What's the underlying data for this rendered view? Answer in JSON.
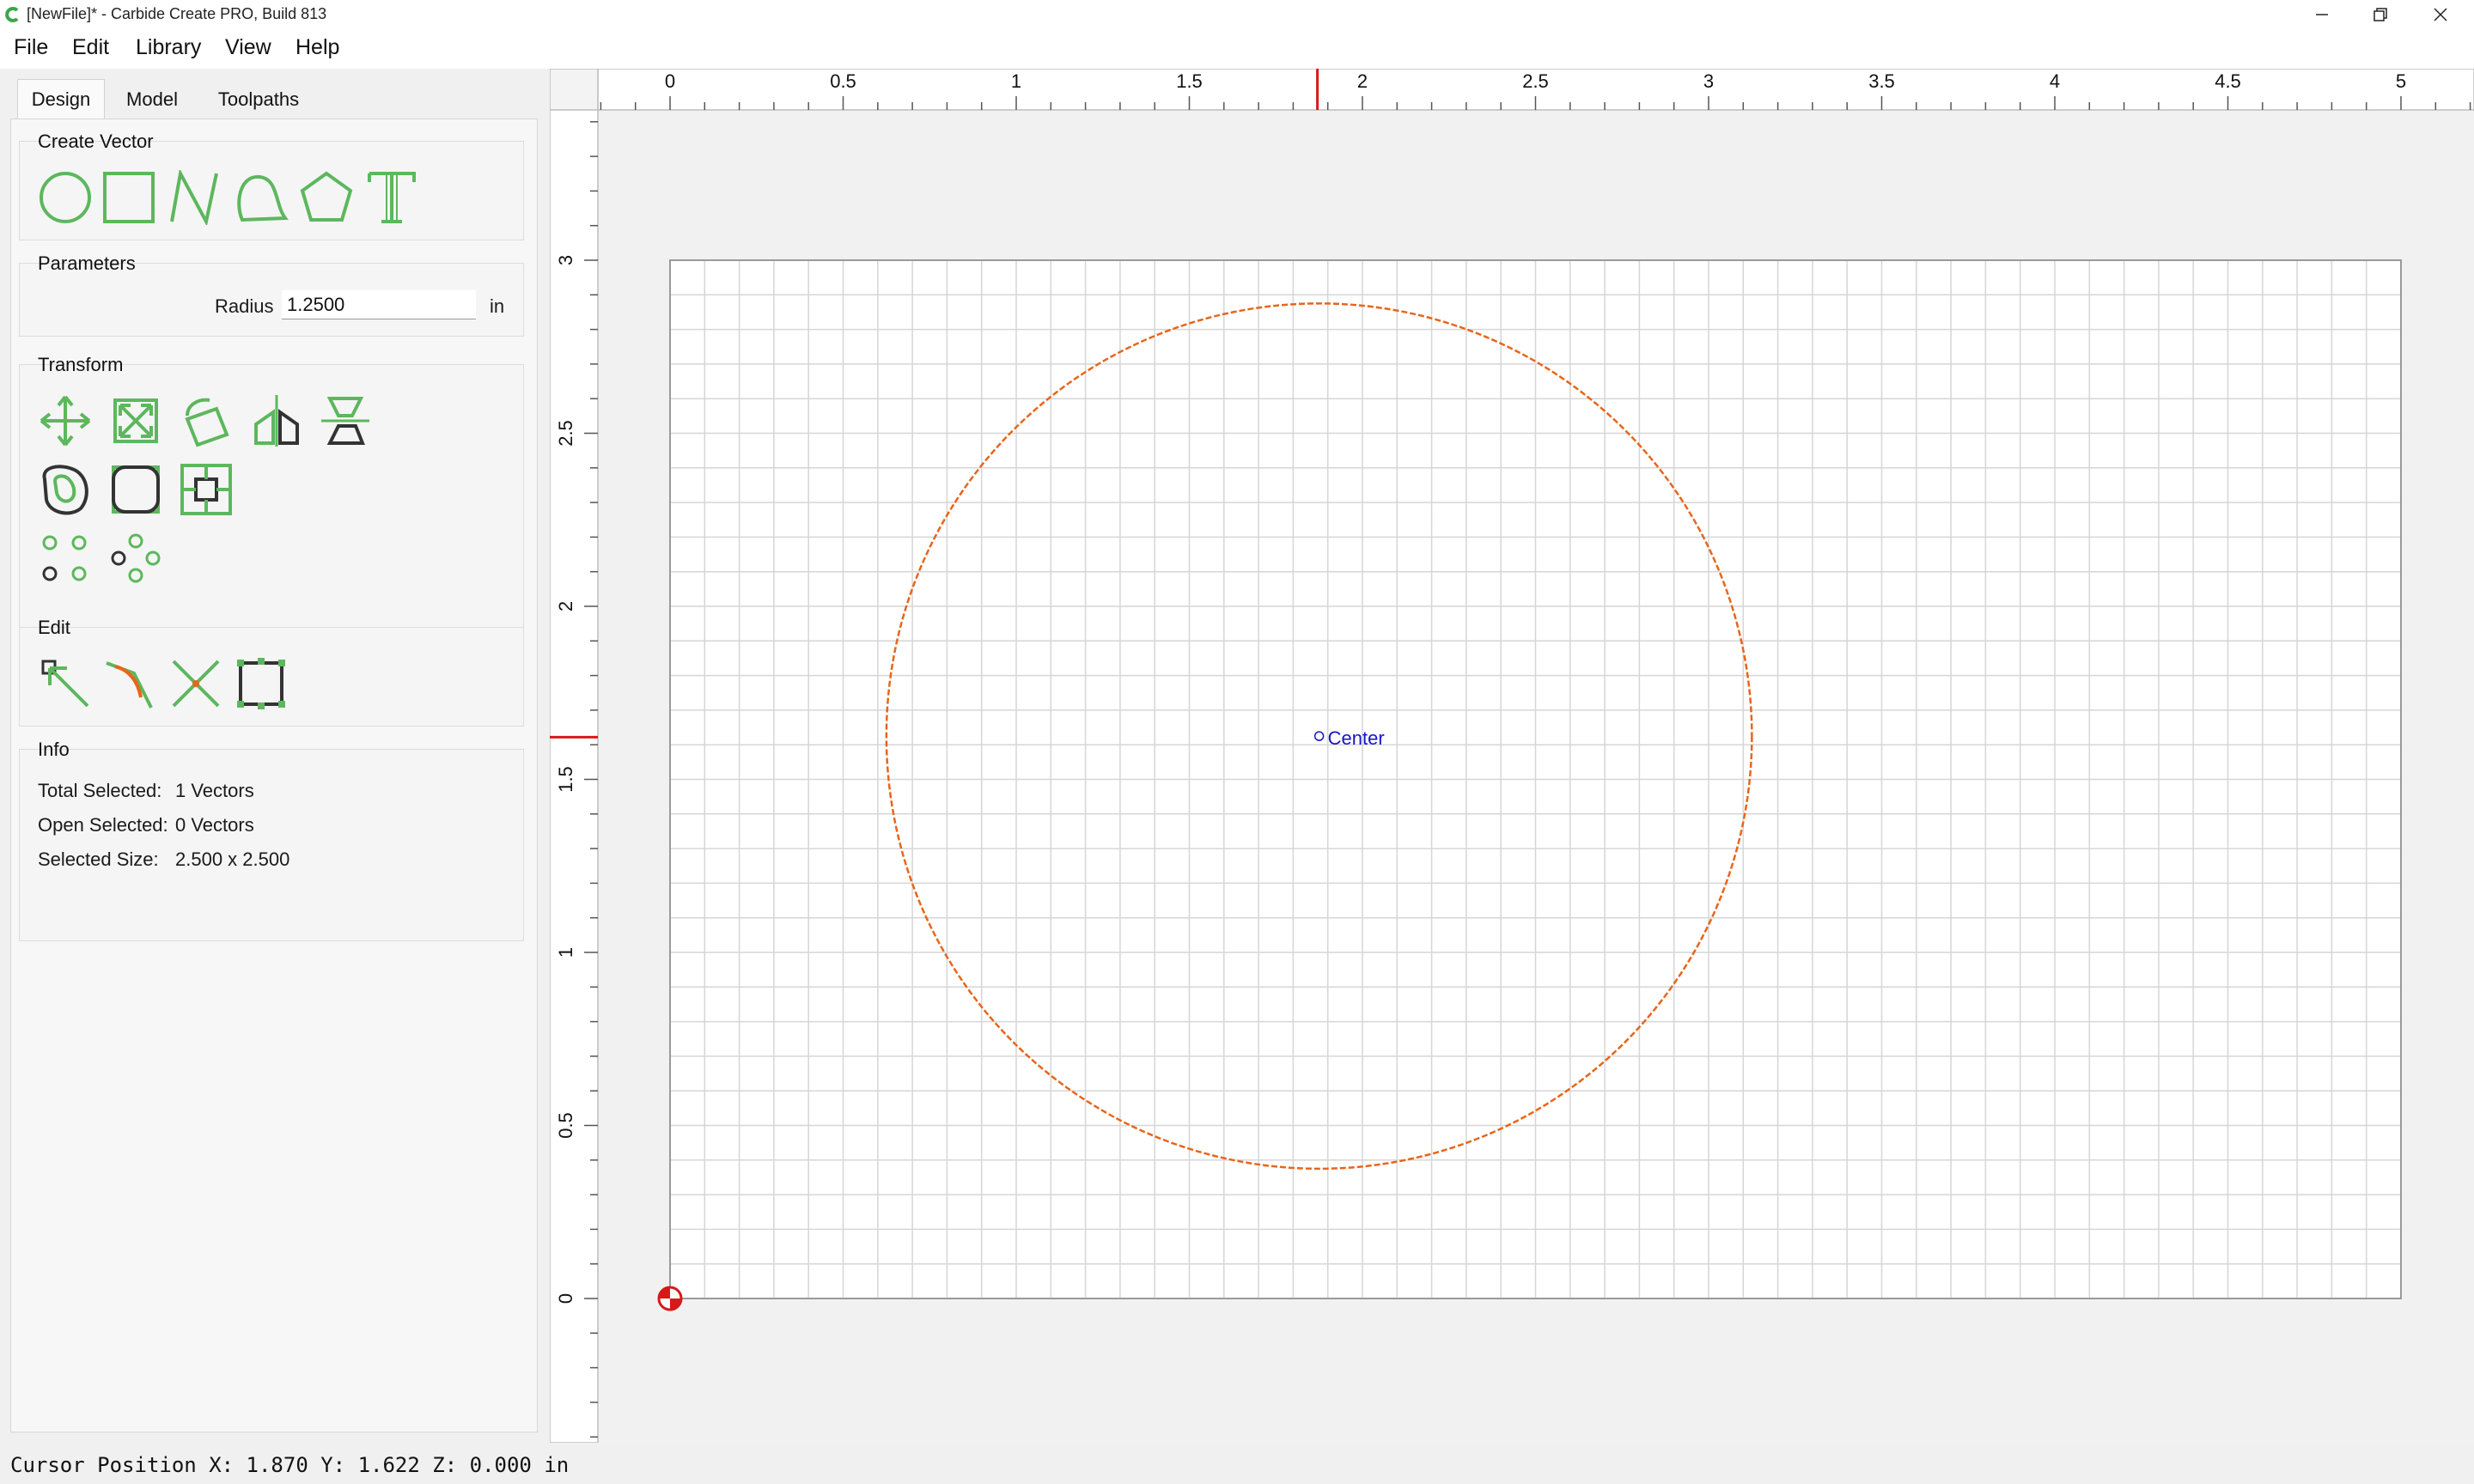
{
  "window": {
    "title": "[NewFile]* - Carbide Create PRO, Build 813",
    "controls": [
      "minimize-icon",
      "restore-icon",
      "close-icon"
    ]
  },
  "menu": [
    "File",
    "Edit",
    "Library",
    "View",
    "Help"
  ],
  "tabs": [
    "Design",
    "Model",
    "Toolpaths"
  ],
  "active_tab": "Design",
  "create_vector": {
    "title": "Create Vector",
    "tools": [
      "circle-icon",
      "rectangle-icon",
      "polyline-icon",
      "curve-icon",
      "polygon-icon",
      "text-icon"
    ]
  },
  "parameters": {
    "title": "Parameters",
    "radius_label": "Radius",
    "radius_value": "1.2500",
    "unit": "in"
  },
  "transform": {
    "title": "Transform",
    "tools": [
      "move-icon",
      "scale-icon",
      "rotate-icon",
      "mirror-icon",
      "align-icon",
      "offset-icon",
      "fillet-icon",
      "bounding-box-icon",
      "array-grid-icon",
      "circular-array-icon"
    ]
  },
  "edit": {
    "title": "Edit",
    "tools": [
      "node-edit-icon",
      "tangent-icon",
      "trim-icon",
      "boolean-box-icon"
    ]
  },
  "info": {
    "title": "Info",
    "rows": [
      {
        "label": "Total Selected:",
        "value": "1 Vectors"
      },
      {
        "label": "Open Selected:",
        "value": "0 Vectors"
      },
      {
        "label": "Selected Size:",
        "value": "2.500 x 2.500"
      }
    ]
  },
  "canvas": {
    "x_ruler_labels": [
      "0",
      "0.5",
      "1",
      "1.5",
      "2",
      "2.5",
      "3",
      "3.5",
      "4",
      "4.5",
      "5"
    ],
    "y_ruler_labels": [
      "0",
      "0.5",
      "1",
      "1.5",
      "2",
      "2.5",
      "3"
    ],
    "stock_width": 5.0,
    "stock_height": 3.0,
    "units": "in",
    "circle": {
      "center_x": 1.875,
      "center_y": 1.625,
      "radius": 1.25,
      "color": "#e8651a"
    },
    "center_label": "Center",
    "cursor_marker": {
      "x": 1.87,
      "y": 1.622
    },
    "colors": {
      "grid": "#d6d6d6",
      "stock_bg": "#ffffff",
      "canvas_bg": "#f1f1f1",
      "center": "#1515c8",
      "marker": "#d61a1a"
    }
  },
  "status": "Cursor Position X: 1.870 Y: 1.622 Z: 0.000 in"
}
